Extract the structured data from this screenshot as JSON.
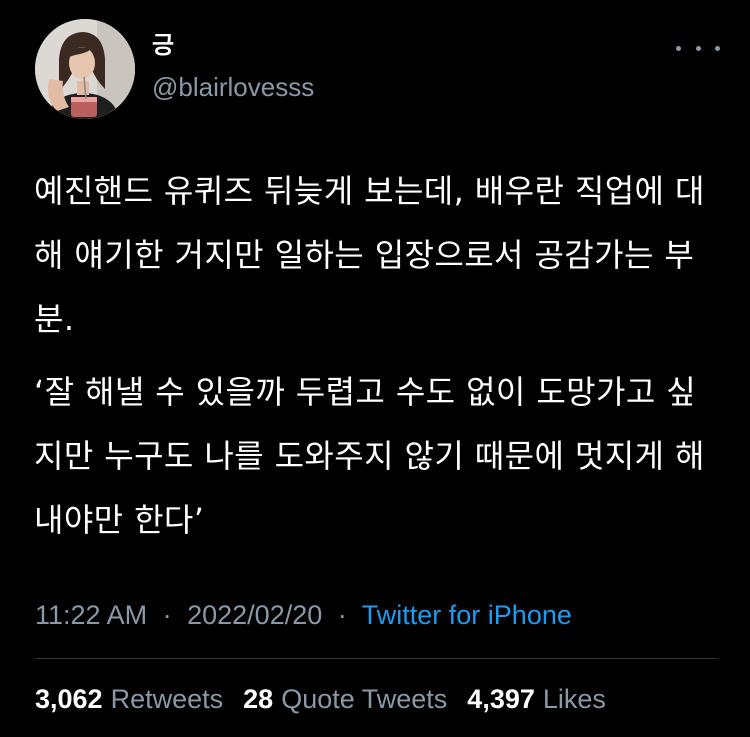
{
  "user": {
    "display_name": "긍",
    "handle": "@blairlovesss"
  },
  "tweet": {
    "paragraph1": "예진핸드 유퀴즈 뒤늦게 보는데, 배우란 직업에 대해 얘기한 거지만 일하는 입장으로서 공감가는 부분.",
    "paragraph2": "‘잘 해낼 수 있을까 두렵고 수도 없이 도망가고 싶지만 누구도 나를 도와주지 않기 때문에 멋지게 해내야만 한다’"
  },
  "meta": {
    "time": "11:22 AM",
    "separator": "·",
    "date": "2022/02/20",
    "source": "Twitter for iPhone"
  },
  "stats": {
    "retweets_count": "3,062",
    "retweets_label": "Retweets",
    "quote_count": "28",
    "quote_label": "Quote Tweets",
    "likes_count": "4,397",
    "likes_label": "Likes"
  },
  "colors": {
    "background": "#000000",
    "text": "#ffffff",
    "muted": "#8b98a5",
    "link": "#1d9bf0",
    "divider": "#2f3336"
  },
  "icons": {
    "more": "more-horizontal-icon",
    "avatar": "profile-photo"
  }
}
